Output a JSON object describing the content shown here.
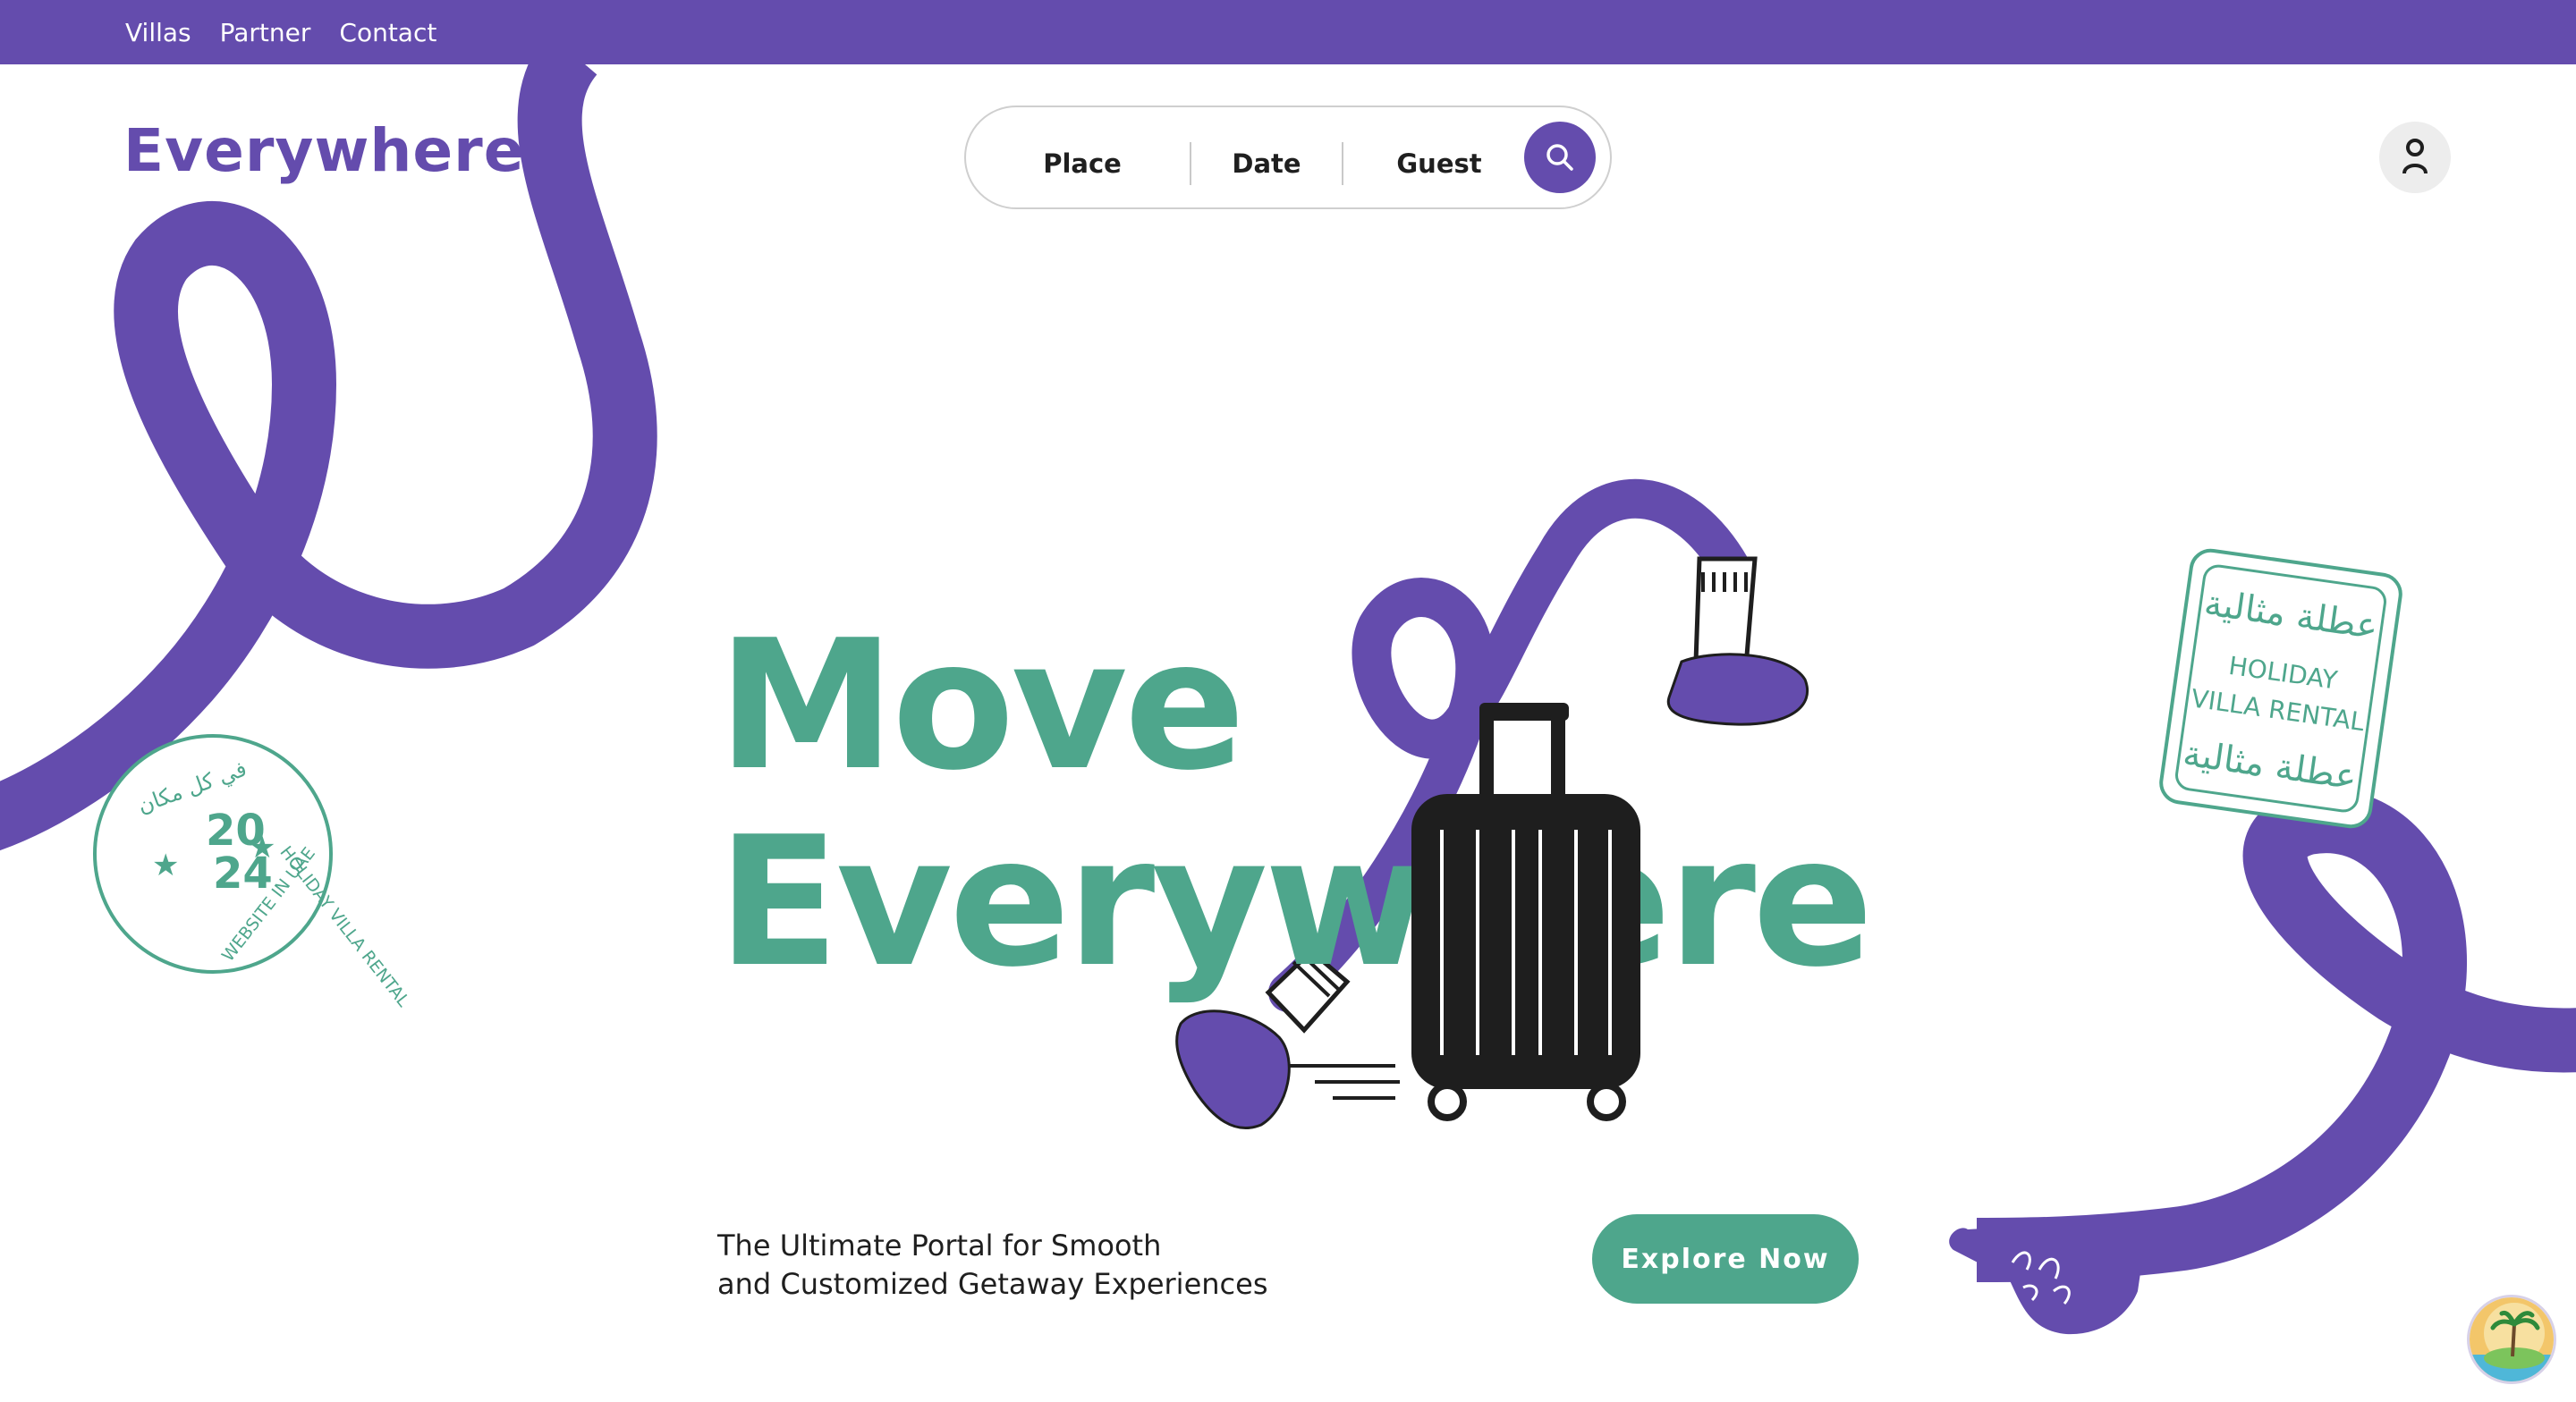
{
  "nav": {
    "links": [
      "Villas",
      "Partner",
      "Contact"
    ]
  },
  "header": {
    "logo": "Everywhere"
  },
  "search": {
    "place": "Place",
    "date": "Date",
    "guest": "Guest",
    "icon": "search-icon"
  },
  "user": {
    "icon": "user-icon"
  },
  "hero": {
    "line1": "Move",
    "line2": "Everywhere",
    "tagline_line1": "The Ultimate Portal for Smooth",
    "tagline_line2": "and Customized Getaway Experiences",
    "cta": "Explore Now"
  },
  "stamp_round": {
    "year_top": "20",
    "year_bottom": "24",
    "arabic": "في كل مكان",
    "text_right": "HOLIDAY VILLA RENTAL",
    "text_left": "WEBSITE IN UAE"
  },
  "stamp_square": {
    "arabic": "عطلة مثالية",
    "line1": "HOLIDAY",
    "line2": "VILLA RENTAL"
  },
  "colors": {
    "brand_purple": "#644cad",
    "brand_green": "#4ea68c",
    "luggage": "#1e1e1e"
  }
}
